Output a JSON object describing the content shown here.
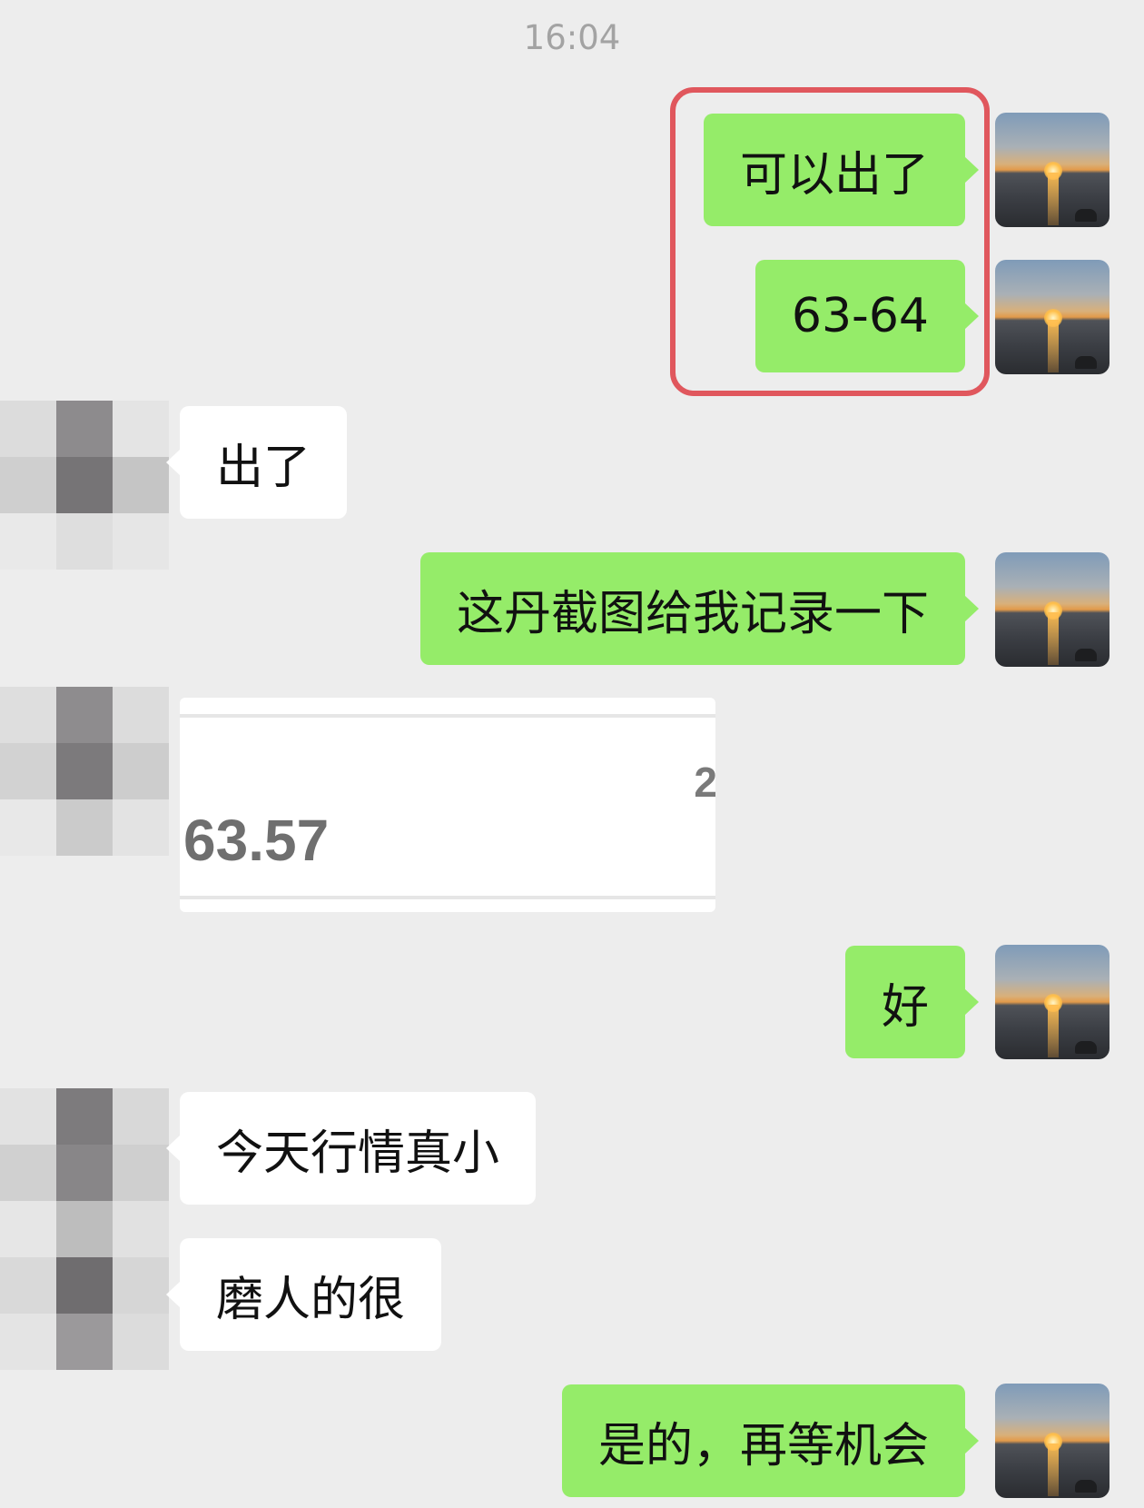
{
  "time": "16:04",
  "messages": [
    {
      "from": "me",
      "text": "可以出了"
    },
    {
      "from": "me",
      "text": "63-64"
    },
    {
      "from": "other",
      "text": "出了"
    },
    {
      "from": "me",
      "text": "这丹截图给我记录一下"
    },
    {
      "from": "other",
      "type": "image",
      "value": "63.57",
      "edge_char": "2"
    },
    {
      "from": "me",
      "text": "好"
    },
    {
      "from": "other",
      "text": "今天行情真小"
    },
    {
      "from": "other",
      "text": "磨人的很"
    },
    {
      "from": "me",
      "text": "是的，再等机会"
    }
  ],
  "avatars": {
    "me": "sunset-avatar",
    "other": "pixelated-avatar"
  },
  "colors": {
    "my_bubble": "#95ec69",
    "their_bubble": "#ffffff",
    "background": "#ededed",
    "highlight": "#e0575d"
  }
}
